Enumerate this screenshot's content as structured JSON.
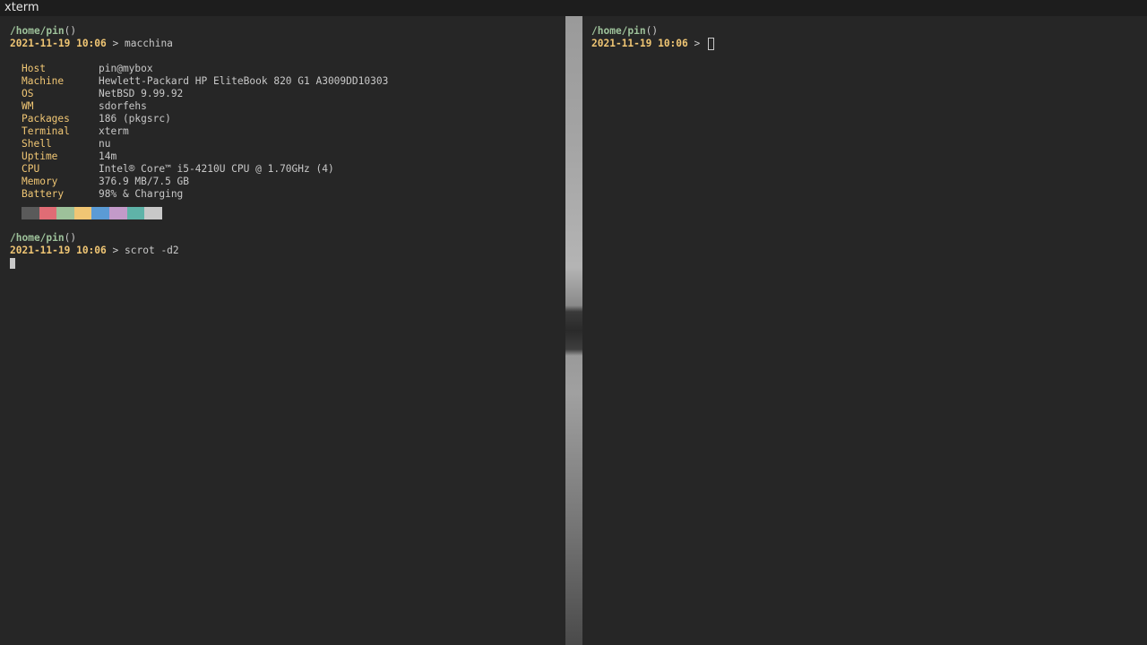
{
  "window": {
    "title": "xterm"
  },
  "left_terminal": {
    "prompt1": {
      "path": "/home/pin",
      "paren": "()",
      "datetime": "2021-11-19 10:06",
      "arrow": ">",
      "command": "macchina"
    },
    "info": [
      {
        "key": "Host",
        "value": "pin@mybox"
      },
      {
        "key": "Machine",
        "value": "Hewlett-Packard HP EliteBook 820 G1 A3009DD10303"
      },
      {
        "key": "OS",
        "value": "NetBSD 9.99.92"
      },
      {
        "key": "WM",
        "value": "sdorfehs"
      },
      {
        "key": "Packages",
        "value": "186 (pkgsrc)"
      },
      {
        "key": "Terminal",
        "value": "xterm"
      },
      {
        "key": "Shell",
        "value": "nu"
      },
      {
        "key": "Uptime",
        "value": "14m"
      },
      {
        "key": "CPU",
        "value": "Intel® Core™ i5-4210U CPU @ 1.70GHz (4)"
      },
      {
        "key": "Memory",
        "value": "376.9 MB/7.5 GB"
      },
      {
        "key": "Battery",
        "value": "98% & Charging"
      }
    ],
    "palette": [
      "#5a5a5a",
      "#e06c75",
      "#9dc19a",
      "#f0c674",
      "#5b9bd5",
      "#c39ac9",
      "#5fb3a8",
      "#c8c8c8"
    ],
    "prompt2": {
      "path": "/home/pin",
      "paren": "()",
      "datetime": "2021-11-19 10:06",
      "arrow": ">",
      "command": "scrot -d2"
    }
  },
  "right_terminal": {
    "prompt": {
      "path": "/home/pin",
      "paren": "()",
      "datetime": "2021-11-19 10:06",
      "arrow": ">"
    }
  }
}
